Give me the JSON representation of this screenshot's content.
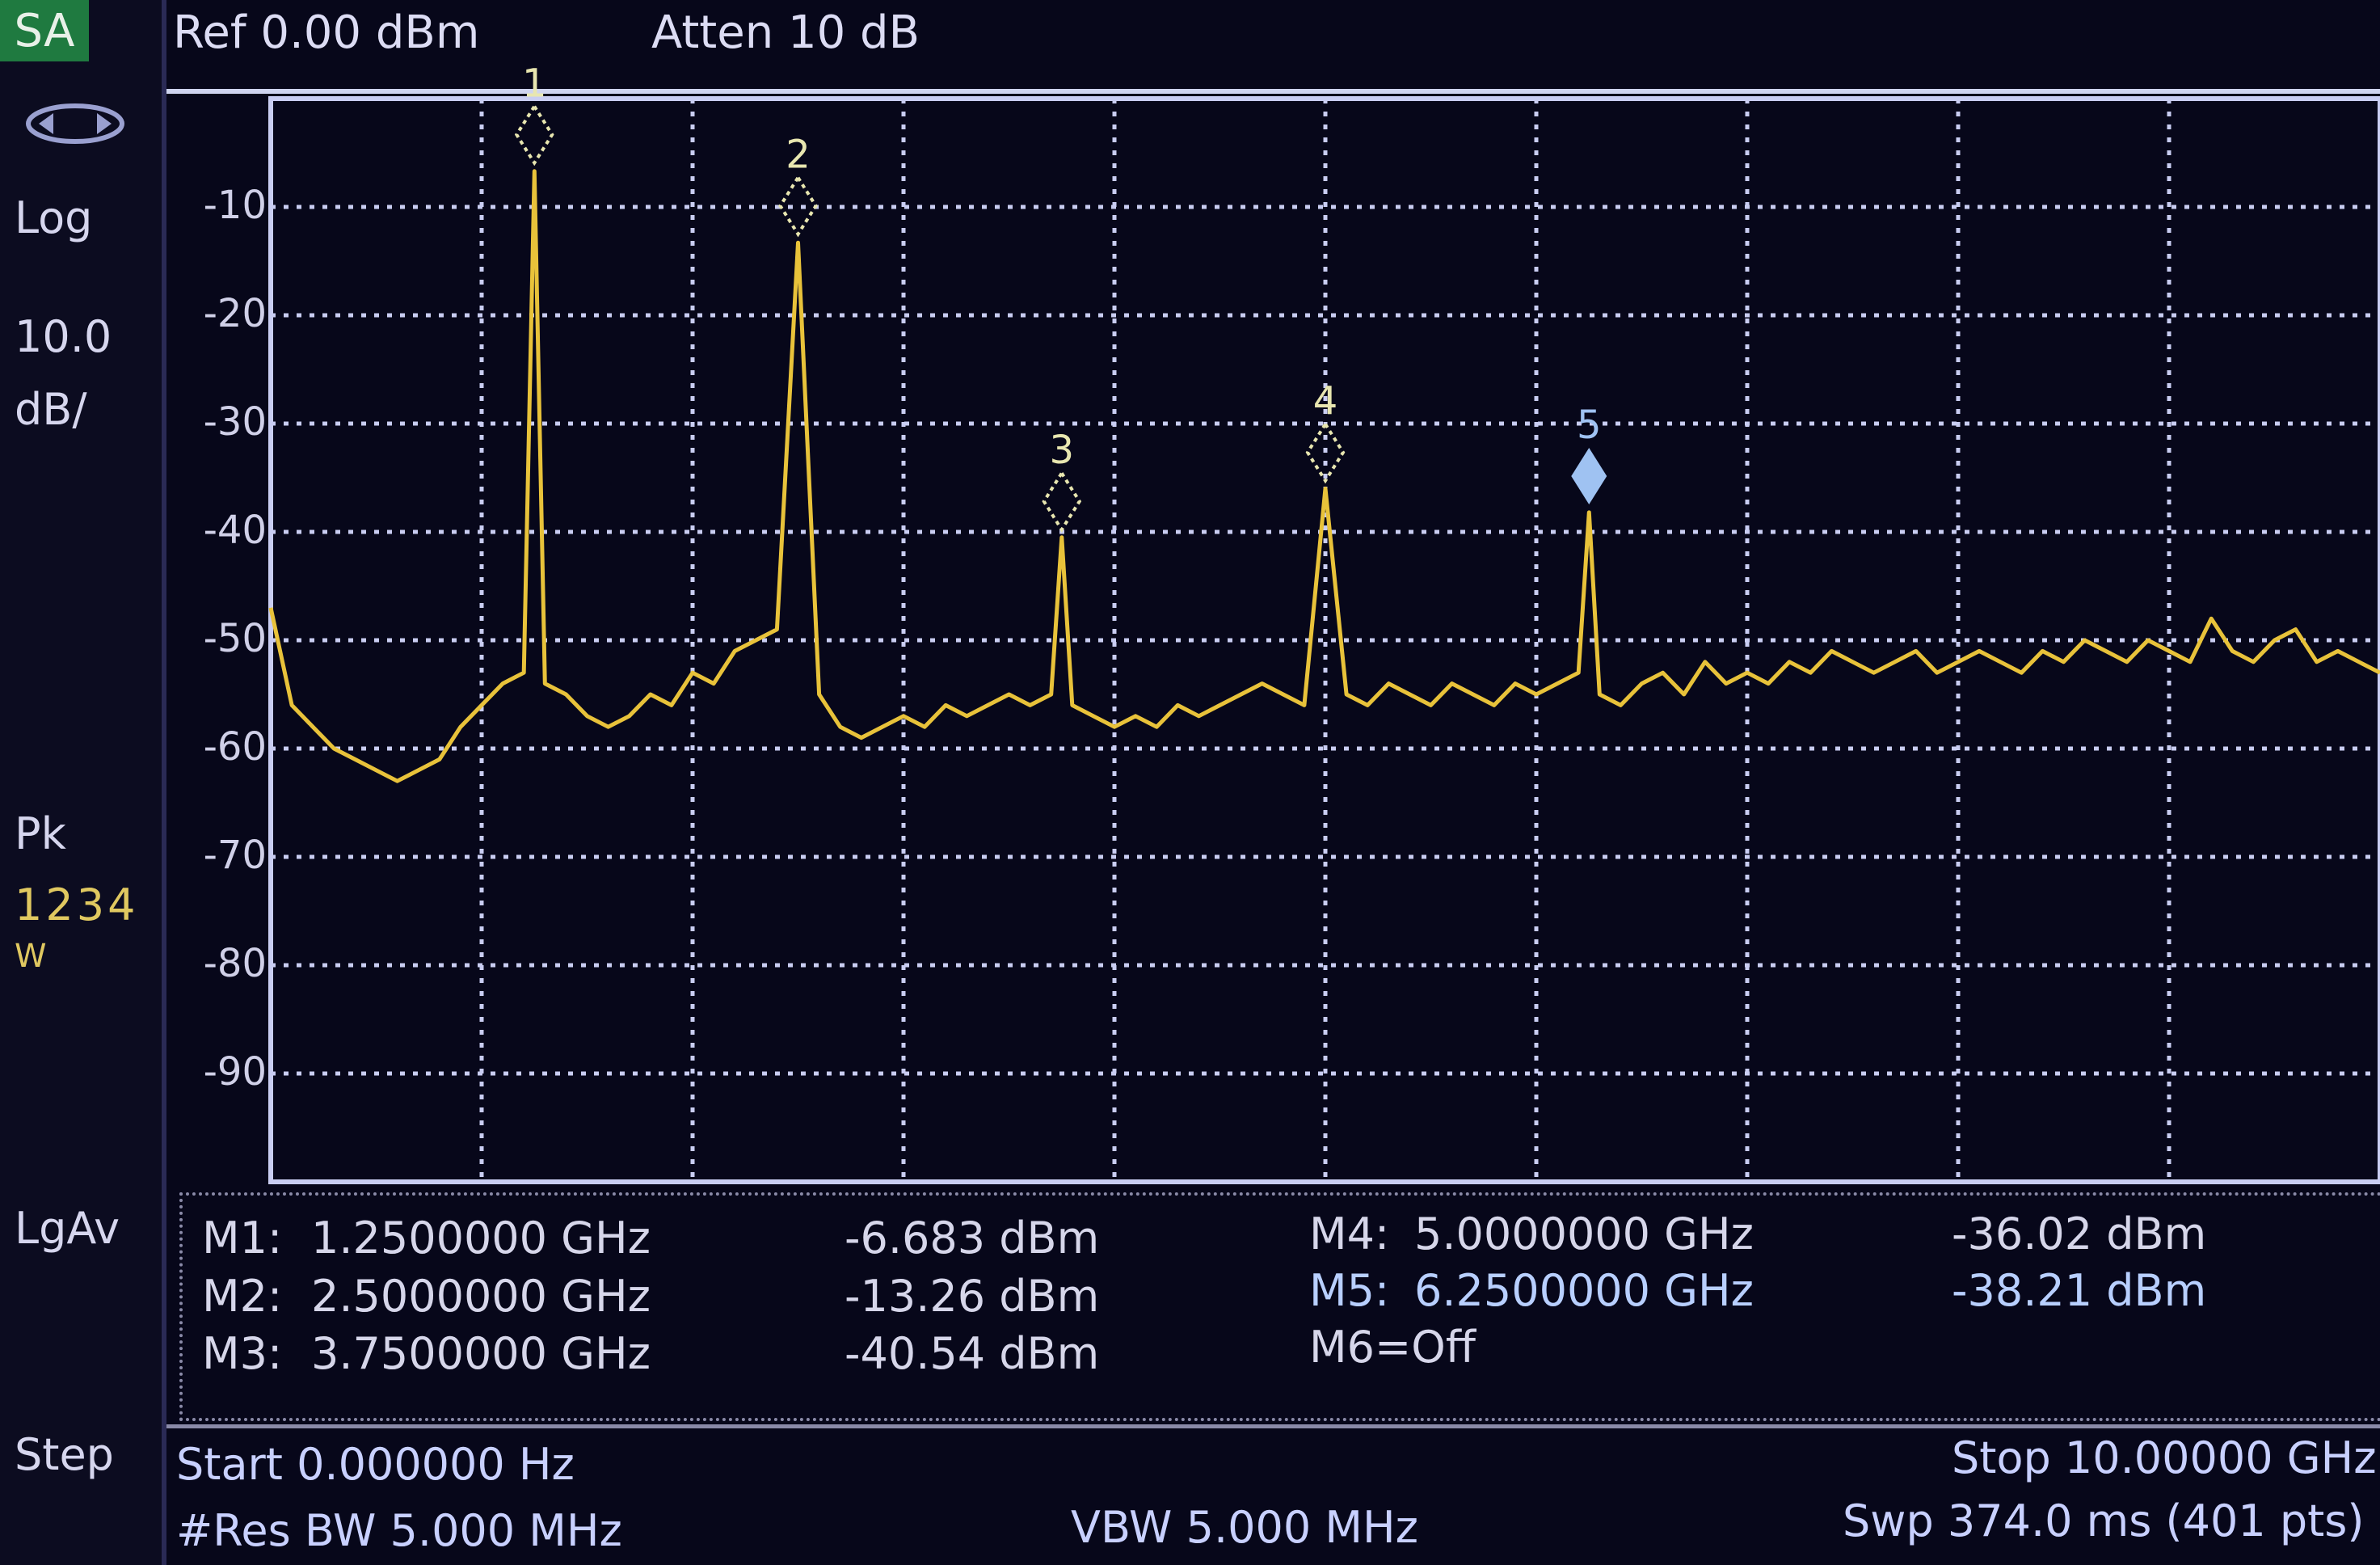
{
  "sidebar": {
    "mode": "SA",
    "scale_type": "Log",
    "scale_per_div": "10.0",
    "scale_unit": "dB/",
    "detector": "Pk",
    "traces": "1234",
    "trace_mode": "W",
    "avg_type": "LgAv",
    "step_label": "Step"
  },
  "top": {
    "ref_level": "Ref 0.00 dBm",
    "attenuation": "Atten 10 dB"
  },
  "chart_data": {
    "type": "line",
    "xlim": [
      0,
      10
    ],
    "x_unit": "GHz",
    "ylim": [
      -100,
      0
    ],
    "y_unit": "dBm",
    "y_ticks": [
      -10,
      -20,
      -30,
      -40,
      -50,
      -60,
      -70,
      -80,
      -90
    ],
    "y_tick_labels": [
      "-10",
      "-20",
      "-30",
      "-40",
      "-50",
      "-60",
      "-70",
      "-80",
      "-90"
    ],
    "grid": true,
    "trace_color": "#e8c23a",
    "series": [
      {
        "x": [
          0.0,
          0.1,
          0.2,
          0.3,
          0.4,
          0.5,
          0.6,
          0.7,
          0.8,
          0.9,
          1.0,
          1.1,
          1.2,
          1.25,
          1.3,
          1.4,
          1.5,
          1.6,
          1.7,
          1.8,
          1.9,
          2.0,
          2.1,
          2.2,
          2.3,
          2.4,
          2.5,
          2.6,
          2.7,
          2.8,
          2.9,
          3.0,
          3.1,
          3.2,
          3.3,
          3.4,
          3.5,
          3.6,
          3.7,
          3.75,
          3.8,
          3.9,
          4.0,
          4.1,
          4.2,
          4.3,
          4.4,
          4.5,
          4.6,
          4.7,
          4.8,
          4.9,
          5.0,
          5.1,
          5.2,
          5.3,
          5.4,
          5.5,
          5.6,
          5.7,
          5.8,
          5.9,
          6.0,
          6.1,
          6.2,
          6.25,
          6.3,
          6.4,
          6.5,
          6.6,
          6.7,
          6.8,
          6.9,
          7.0,
          7.1,
          7.2,
          7.3,
          7.4,
          7.5,
          7.6,
          7.7,
          7.8,
          7.9,
          8.0,
          8.1,
          8.2,
          8.3,
          8.4,
          8.5,
          8.6,
          8.7,
          8.8,
          8.9,
          9.0,
          9.1,
          9.2,
          9.3,
          9.4,
          9.5,
          9.6,
          9.7,
          9.8,
          9.9,
          10.0
        ],
        "y": [
          -47,
          -56,
          -58,
          -60,
          -61,
          -62,
          -63,
          -62,
          -61,
          -58,
          -56,
          -54,
          -53,
          -6.7,
          -54,
          -55,
          -57,
          -58,
          -57,
          -55,
          -56,
          -53,
          -54,
          -51,
          -50,
          -49,
          -13.3,
          -55,
          -58,
          -59,
          -58,
          -57,
          -58,
          -56,
          -57,
          -56,
          -55,
          -56,
          -55,
          -40.5,
          -56,
          -57,
          -58,
          -57,
          -58,
          -56,
          -57,
          -56,
          -55,
          -54,
          -55,
          -56,
          -36.0,
          -55,
          -56,
          -54,
          -55,
          -56,
          -54,
          -55,
          -56,
          -54,
          -55,
          -54,
          -53,
          -38.2,
          -55,
          -56,
          -54,
          -53,
          -55,
          -52,
          -54,
          -53,
          -54,
          -52,
          -53,
          -51,
          -52,
          -53,
          -52,
          -51,
          -53,
          -52,
          -51,
          -52,
          -53,
          -51,
          -52,
          -50,
          -51,
          -52,
          -50,
          -51,
          -52,
          -48,
          -51,
          -52,
          -50,
          -49,
          -52,
          -51,
          -52,
          -53
        ]
      }
    ],
    "markers": [
      {
        "label": "1",
        "x": 1.25,
        "y": -6.683,
        "active": false
      },
      {
        "label": "2",
        "x": 2.5,
        "y": -13.26,
        "active": false
      },
      {
        "label": "3",
        "x": 3.75,
        "y": -40.54,
        "active": false
      },
      {
        "label": "4",
        "x": 5.0,
        "y": -36.02,
        "active": false
      },
      {
        "label": "5",
        "x": 6.25,
        "y": -38.21,
        "active": true
      }
    ]
  },
  "marker_table": {
    "m1_name": "M1:",
    "m1_freq": "1.2500000 GHz",
    "m1_amp": "-6.683 dBm",
    "m2_name": "M2:",
    "m2_freq": "2.5000000 GHz",
    "m2_amp": "-13.26 dBm",
    "m3_name": "M3:",
    "m3_freq": "3.7500000 GHz",
    "m3_amp": "-40.54 dBm",
    "m4_name": "M4:",
    "m4_freq": "5.0000000 GHz",
    "m4_amp": "-36.02 dBm",
    "m5_name": "M5:",
    "m5_freq": "6.2500000 GHz",
    "m5_amp": "-38.21 dBm",
    "m6_status": "M6=Off"
  },
  "bottom": {
    "start": "Start 0.000000  Hz",
    "stop": "Stop 10.00000 GHz",
    "rbw": "#Res BW 5.000 MHz",
    "vbw": "VBW 5.000 MHz",
    "sweep": "Swp 374.0 ms (401 pts)"
  },
  "colors": {
    "background": "#07071a",
    "grid": "#c9cdf2",
    "trace": "#e8c23a",
    "marker": "#e8e6b0",
    "active_marker": "#9fc2f2"
  }
}
